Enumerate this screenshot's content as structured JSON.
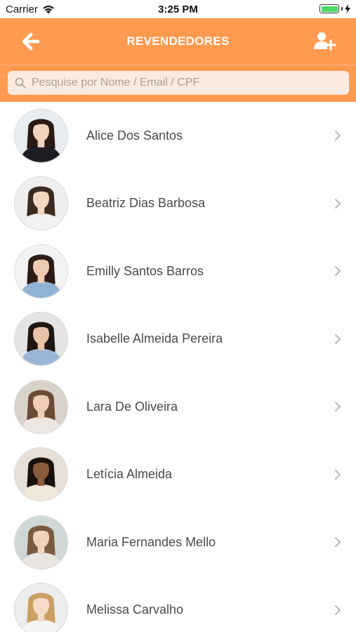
{
  "status_bar": {
    "carrier": "Carrier",
    "time": "3:25 PM",
    "battery_color": "#4cd964"
  },
  "nav": {
    "title": "REVENDEDORES",
    "back_icon": "arrow-left-icon",
    "add_icon": "add-user-icon",
    "bar_color": "#ff9a4f"
  },
  "search": {
    "placeholder": "Pesquise por Nome / Email / CPF",
    "value": ""
  },
  "resellers": [
    {
      "name": "Alice Dos Santos",
      "hair": "#2a1a14",
      "skin": "#f1d3bd",
      "top": "#1d1d24",
      "bg": "#e8ecef"
    },
    {
      "name": "Beatriz Dias Barbosa",
      "hair": "#3a2a1f",
      "skin": "#f3d6c2",
      "top": "#f2f2f2",
      "bg": "#eeeeee"
    },
    {
      "name": "Emilly Santos Barros",
      "hair": "#2b1d16",
      "skin": "#eecbb1",
      "top": "#8fb2d6",
      "bg": "#f3f3f3"
    },
    {
      "name": "Isabelle Almeida Pereira",
      "hair": "#1e1612",
      "skin": "#e9c3a8",
      "top": "#9bb6d4",
      "bg": "#e4e4e4"
    },
    {
      "name": "Lara De Oliveira",
      "hair": "#6b4a35",
      "skin": "#f0cdb3",
      "top": "#ece7e2",
      "bg": "#d9d2c8"
    },
    {
      "name": "Letícia Almeida",
      "hair": "#1a100b",
      "skin": "#8a5a3c",
      "top": "#f1e6da",
      "bg": "#e7dfd6"
    },
    {
      "name": "Maria Fernandes Mello",
      "hair": "#7a5a40",
      "skin": "#f2d2bb",
      "top": "#e9e5e0",
      "bg": "#cfd8d6"
    },
    {
      "name": "Melissa Carvalho",
      "hair": "#c9a062",
      "skin": "#f4dcc8",
      "top": "#f5f5f5",
      "bg": "#ececec"
    }
  ]
}
